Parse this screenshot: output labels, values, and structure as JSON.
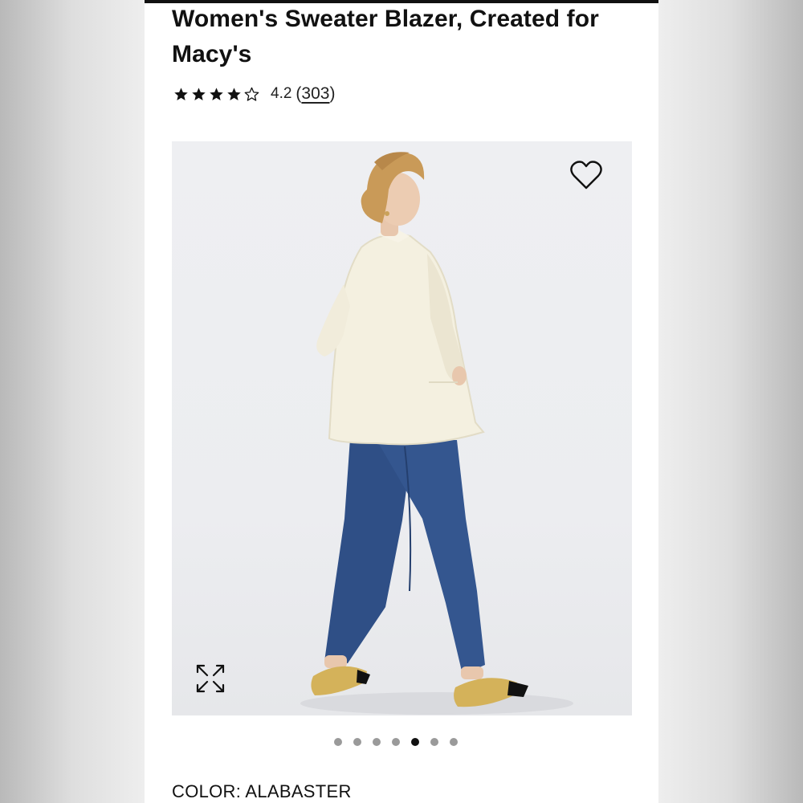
{
  "product": {
    "title": "Women's Sweater Blazer, Created for Macy's",
    "rating": {
      "stars": 4.2,
      "value_label": "4.2",
      "open_paren": "(",
      "count": "303",
      "close_paren": ")"
    },
    "color": {
      "label": "COLOR:",
      "value": "ALABASTER"
    }
  },
  "gallery": {
    "image_count": 7,
    "active_index": 4,
    "icons": {
      "wishlist": "heart-icon",
      "zoom": "expand-icon"
    }
  },
  "colors": {
    "text": "#111111",
    "dot_inactive": "#9a9a9a",
    "dot_active": "#111111"
  }
}
